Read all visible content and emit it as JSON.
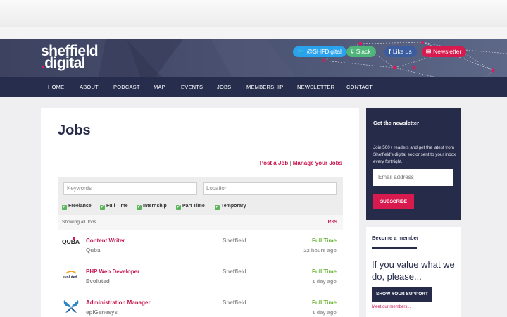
{
  "site": {
    "logo_line1": "sheffield",
    "logo_dot": ".",
    "logo_line2": "digital"
  },
  "social": [
    {
      "icon": "twitter-icon",
      "label": "@SHFDigital",
      "color": "#2aa3ef"
    },
    {
      "icon": "slack-icon",
      "label": "Slack",
      "color": "#4fb57a"
    },
    {
      "icon": "facebook-icon",
      "label": "Like us",
      "color": "#3b5c9e"
    },
    {
      "icon": "mail-icon",
      "label": "Newsletter",
      "color": "#d81a4f"
    }
  ],
  "nav": [
    "HOME",
    "ABOUT",
    "PODCAST",
    "MAP",
    "EVENTS",
    "JOBS",
    "MEMBERSHIP",
    "NEWSLETTER",
    "CONTACT"
  ],
  "jobs": {
    "title": "Jobs",
    "post_link": "Post a Job",
    "separator": "|",
    "manage_link": "Manage your Jobs",
    "keywords_placeholder": "Keywords",
    "location_placeholder": "Location",
    "filters": [
      "Freelance",
      "Full Time",
      "Internship",
      "Part Time",
      "Temporary"
    ],
    "showing": "Showing all Jobs",
    "rss": "RSS",
    "listings": [
      {
        "logo": "quba-logo",
        "logo_text": "QUBA",
        "title": "Content Writer",
        "company": "Quba",
        "location": "Sheffield",
        "type": "Full Time",
        "posted": "22 hours ago"
      },
      {
        "logo": "evoluted-logo",
        "logo_text": "evoluted",
        "title": "PHP Web Developer",
        "company": "Evoluted",
        "location": "Sheffield",
        "type": "Full Time",
        "posted": "1 day ago"
      },
      {
        "logo": "butterfly-logo",
        "logo_text": "",
        "title": "Administration Manager",
        "company": "epiGenesys",
        "location": "Sheffield",
        "type": "Full Time",
        "posted": "1 day ago"
      }
    ]
  },
  "newsletter": {
    "title": "Get the newsletter",
    "text": "Join 500+ readers and get the latest from Sheffield's digital sector sent to your inbox every fortnight.",
    "email_placeholder": "Email address",
    "subscribe": "SUBSCRIBE"
  },
  "member": {
    "title": "Become a member",
    "headline": "If you value what we do, please...",
    "button": "SHOW YOUR SUPPORT",
    "link": "Meet our members..."
  }
}
